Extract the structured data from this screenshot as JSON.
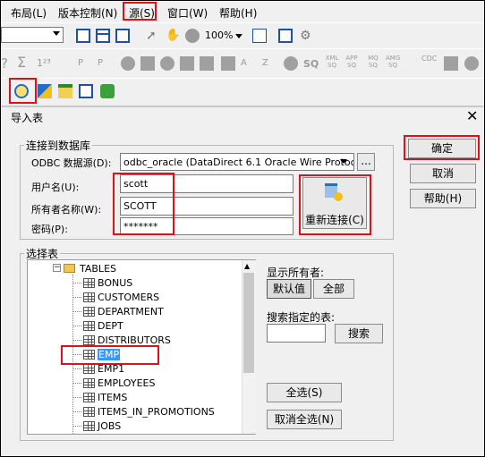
{
  "menubar": {
    "items": [
      "布局(L)",
      "版本控制(N)",
      "源(S)",
      "窗口(W)",
      "帮助(H)"
    ]
  },
  "toolbar1": {
    "zoom": "100%"
  },
  "toolbar2": {
    "sq": "SQ",
    "xml": "XML SQ",
    "app": "APP SQ",
    "mq": "MQ SQ",
    "amg": "AMG SQ",
    "cdc": "CDC"
  },
  "dialog": {
    "title": "导入表",
    "connect_group": "连接到数据库",
    "odbc_label": "ODBC 数据源(D):",
    "odbc_value": "odbc_oracle (DataDirect 6.1 Oracle Wire Protocol)",
    "browse_label": "...",
    "user_label": "用户名(U):",
    "user_value": "scott",
    "owner_label": "所有者名称(W):",
    "owner_value": "SCOTT",
    "password_label": "密码(P):",
    "password_value": "*******",
    "reconnect_label": "重新连接(C)",
    "ok_label": "确定",
    "cancel_label": "取消",
    "help_label": "帮助(H)",
    "select_group": "选择表",
    "tree_root": "TABLES",
    "tables": [
      "BONUS",
      "CUSTOMERS",
      "DEPARTMENT",
      "DEPT",
      "DISTRIBUTORS",
      "EMP",
      "EMP1",
      "EMPLOYEES",
      "ITEMS",
      "ITEMS_IN_PROMOTIONS",
      "JOBS"
    ],
    "selected_table": "EMP",
    "show_owner_label": "显示所有者:",
    "default_label": "默认值",
    "all_label": "全部",
    "search_label": "搜索指定的表:",
    "search_value": "",
    "search_button": "搜索",
    "select_all": "全选(S)",
    "deselect_all": "取消全选(N)"
  },
  "colors": {
    "highlight": "#e0101a",
    "selection": "#3399ff"
  }
}
